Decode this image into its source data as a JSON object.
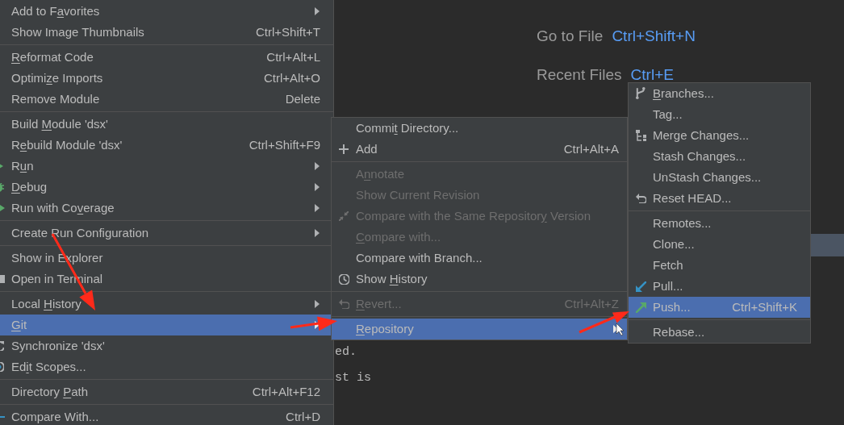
{
  "welcome_hints": [
    {
      "label": "Go to File",
      "shortcut": "Ctrl+Shift+N"
    },
    {
      "label": "Recent Files",
      "shortcut": "Ctrl+E"
    }
  ],
  "editor_lines": [
    "ed.",
    "st is"
  ],
  "context_menu": {
    "items": [
      {
        "kind": "item",
        "label": "Add to Favorites",
        "submenu": true,
        "disabled": false,
        "selected": false
      },
      {
        "kind": "item",
        "label": "Show Image Thumbnails",
        "shortcut": "Ctrl+Shift+T",
        "submenu": false,
        "disabled": false,
        "selected": false
      },
      {
        "kind": "separator"
      },
      {
        "kind": "item",
        "label": "Reformat Code",
        "shortcut": "Ctrl+Alt+L",
        "submenu": false,
        "disabled": false,
        "selected": false
      },
      {
        "kind": "item",
        "label": "Optimize Imports",
        "shortcut": "Ctrl+Alt+O",
        "submenu": false,
        "disabled": false,
        "selected": false
      },
      {
        "kind": "item",
        "label": "Remove Module",
        "shortcut": "Delete",
        "submenu": false,
        "disabled": false,
        "selected": false
      },
      {
        "kind": "separator"
      },
      {
        "kind": "item",
        "label": "Build Module 'dsx'",
        "submenu": false,
        "disabled": false,
        "selected": false
      },
      {
        "kind": "item",
        "label": "Rebuild Module 'dsx'",
        "shortcut": "Ctrl+Shift+F9",
        "submenu": false,
        "disabled": false,
        "selected": false
      },
      {
        "kind": "item",
        "label": "Run",
        "submenu": true,
        "disabled": false,
        "selected": false
      },
      {
        "kind": "item",
        "label": "Debug",
        "submenu": true,
        "disabled": false,
        "selected": false
      },
      {
        "kind": "item",
        "label": "Run with Coverage",
        "submenu": true,
        "disabled": false,
        "selected": false
      },
      {
        "kind": "separator"
      },
      {
        "kind": "item",
        "label": "Create Run Configuration",
        "submenu": true,
        "disabled": false,
        "selected": false
      },
      {
        "kind": "separator"
      },
      {
        "kind": "item",
        "label": "Show in Explorer",
        "submenu": false,
        "disabled": false,
        "selected": false
      },
      {
        "kind": "item",
        "label": "Open in Terminal",
        "submenu": false,
        "disabled": false,
        "selected": false
      },
      {
        "kind": "separator"
      },
      {
        "kind": "item",
        "label": "Local History",
        "submenu": true,
        "disabled": false,
        "selected": false
      },
      {
        "kind": "item",
        "label": "Git",
        "submenu": true,
        "disabled": false,
        "selected": true
      },
      {
        "kind": "item",
        "label": "Synchronize 'dsx'",
        "submenu": false,
        "disabled": false,
        "selected": false
      },
      {
        "kind": "item",
        "label": "Edit Scopes...",
        "submenu": false,
        "disabled": false,
        "selected": false
      },
      {
        "kind": "separator"
      },
      {
        "kind": "item",
        "label": "Directory Path",
        "shortcut": "Ctrl+Alt+F12",
        "submenu": false,
        "disabled": false,
        "selected": false
      },
      {
        "kind": "separator"
      },
      {
        "kind": "item",
        "label": "Compare With...",
        "shortcut": "Ctrl+D",
        "submenu": false,
        "disabled": false,
        "selected": false
      }
    ]
  },
  "git_menu": {
    "items": [
      {
        "kind": "item",
        "label": "Commit Directory...",
        "submenu": false,
        "disabled": false,
        "selected": false
      },
      {
        "kind": "item",
        "label": "Add",
        "shortcut": "Ctrl+Alt+A",
        "submenu": false,
        "disabled": false,
        "selected": false
      },
      {
        "kind": "separator"
      },
      {
        "kind": "item",
        "label": "Annotate",
        "submenu": false,
        "disabled": true,
        "selected": false
      },
      {
        "kind": "item",
        "label": "Show Current Revision",
        "submenu": false,
        "disabled": true,
        "selected": false
      },
      {
        "kind": "item",
        "label": "Compare with the Same Repository Version",
        "submenu": false,
        "disabled": true,
        "selected": false
      },
      {
        "kind": "item",
        "label": "Compare with...",
        "submenu": false,
        "disabled": true,
        "selected": false
      },
      {
        "kind": "item",
        "label": "Compare with Branch...",
        "submenu": false,
        "disabled": false,
        "selected": false
      },
      {
        "kind": "item",
        "label": "Show History",
        "submenu": false,
        "disabled": false,
        "selected": false
      },
      {
        "kind": "separator"
      },
      {
        "kind": "item",
        "label": "Revert...",
        "shortcut": "Ctrl+Alt+Z",
        "submenu": false,
        "disabled": true,
        "selected": false
      },
      {
        "kind": "separator"
      },
      {
        "kind": "item",
        "label": "Repository",
        "submenu": true,
        "disabled": false,
        "selected": true
      }
    ]
  },
  "repository_menu": {
    "items": [
      {
        "kind": "item",
        "label": "Branches...",
        "submenu": false,
        "disabled": false,
        "selected": false
      },
      {
        "kind": "item",
        "label": "Tag...",
        "submenu": false,
        "disabled": false,
        "selected": false
      },
      {
        "kind": "item",
        "label": "Merge Changes...",
        "submenu": false,
        "disabled": false,
        "selected": false
      },
      {
        "kind": "item",
        "label": "Stash Changes...",
        "submenu": false,
        "disabled": false,
        "selected": false
      },
      {
        "kind": "item",
        "label": "UnStash Changes...",
        "submenu": false,
        "disabled": false,
        "selected": false
      },
      {
        "kind": "item",
        "label": "Reset HEAD...",
        "submenu": false,
        "disabled": false,
        "selected": false
      },
      {
        "kind": "separator"
      },
      {
        "kind": "item",
        "label": "Remotes...",
        "submenu": false,
        "disabled": false,
        "selected": false
      },
      {
        "kind": "item",
        "label": "Clone...",
        "submenu": false,
        "disabled": false,
        "selected": false
      },
      {
        "kind": "item",
        "label": "Fetch",
        "submenu": false,
        "disabled": false,
        "selected": false
      },
      {
        "kind": "item",
        "label": "Pull...",
        "submenu": false,
        "disabled": false,
        "selected": false
      },
      {
        "kind": "item",
        "label": "Push...",
        "shortcut": "Ctrl+Shift+K",
        "submenu": false,
        "disabled": false,
        "selected": true
      },
      {
        "kind": "separator"
      },
      {
        "kind": "item",
        "label": "Rebase...",
        "submenu": false,
        "disabled": false,
        "selected": false
      }
    ]
  }
}
